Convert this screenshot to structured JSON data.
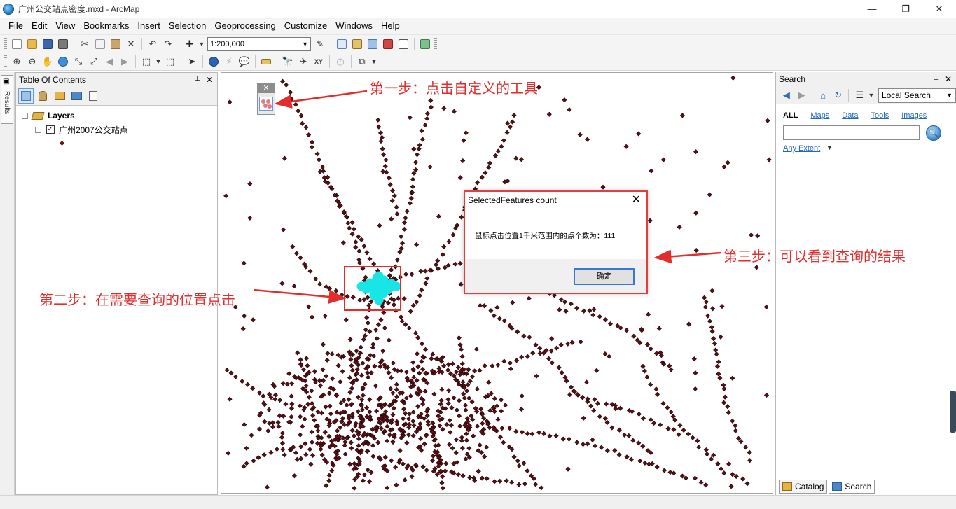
{
  "window": {
    "title": "广州公交站点密度.mxd - ArcMap",
    "minimize": "—",
    "restore": "❐",
    "close": "✕"
  },
  "menu": [
    "File",
    "Edit",
    "View",
    "Bookmarks",
    "Insert",
    "Selection",
    "Geoprocessing",
    "Customize",
    "Windows",
    "Help"
  ],
  "toolbar": {
    "scale_value": "1:200,000"
  },
  "results_tab": {
    "label": "Results"
  },
  "toc": {
    "title": "Table Of Contents",
    "pin": "📌",
    "close": "✕",
    "root_label": "Layers",
    "layer_label": "广州2007公交站点",
    "layer_checked": "✓"
  },
  "map": {
    "point_color": "#5c0f14",
    "highlight_color": "#18e6e6",
    "mini_close": "✕"
  },
  "dialog": {
    "title": "SelectedFeatures count",
    "close": "✕",
    "message": "鼠标点击位置1千米范围内的点个数为：111",
    "ok_label": "确定"
  },
  "search": {
    "title": "Search",
    "pin": "📌",
    "close": "✕",
    "scope": "Local Search",
    "filters": [
      "ALL",
      "Maps",
      "Data",
      "Tools",
      "Images"
    ],
    "query": "",
    "extent": "Any Extent"
  },
  "bottom_tabs": [
    "Catalog",
    "Search"
  ],
  "annotations": {
    "step1": "第一步：点击自定义的工具",
    "step2": "第二步：在需要查询的位置点击",
    "step3": "第三步：可以看到查询的结果",
    "color": "#e32d2d"
  }
}
